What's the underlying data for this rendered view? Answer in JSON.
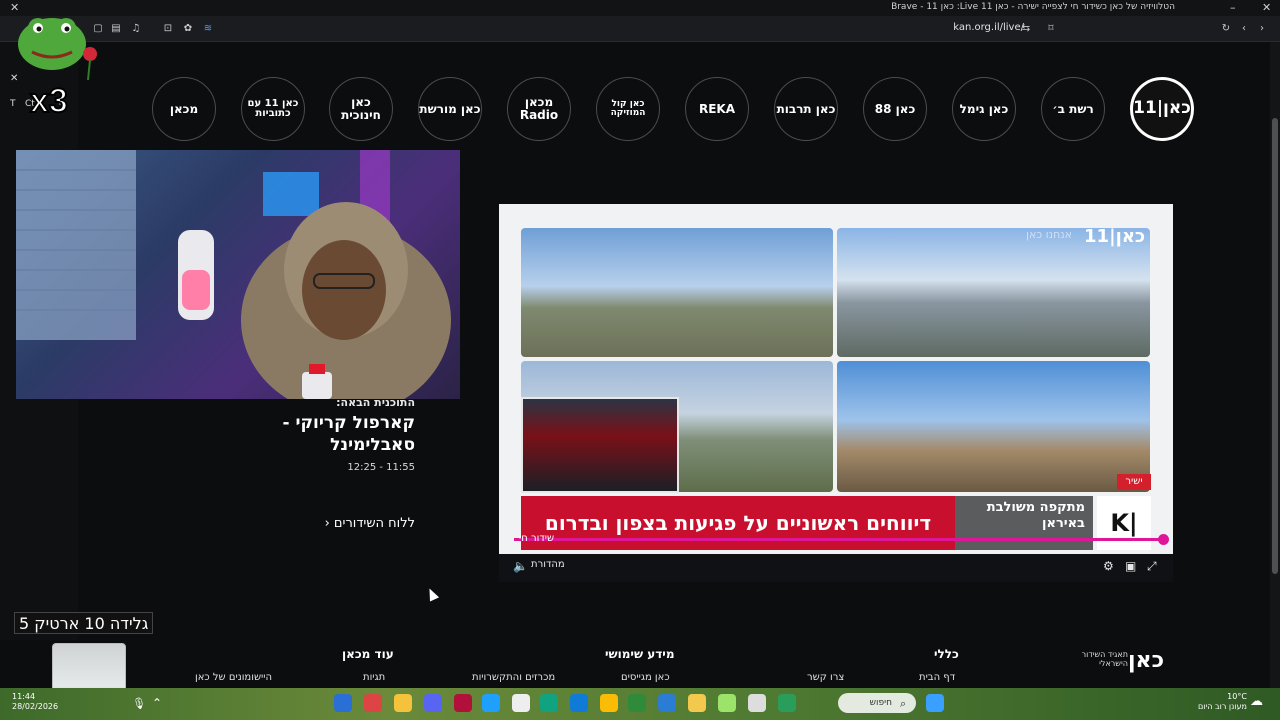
{
  "browser": {
    "window_title": "הטלוויזיה של כאן כשידור חי לצפייה ישירה - כאן 11 Live: כאן 11 - Brave",
    "url": "kan.org.il/live/"
  },
  "channels": [
    {
      "name": "kan11",
      "label": "כאן|11"
    },
    {
      "name": "reshet-bet",
      "label": "רשת ב׳"
    },
    {
      "name": "kan-gimmel",
      "label": "כאן גימל"
    },
    {
      "name": "kan-88",
      "label": "כאן 88"
    },
    {
      "name": "kan-tarbut",
      "label": "כאן תרבות"
    },
    {
      "name": "reka",
      "label": "REKA"
    },
    {
      "name": "kol-hamusika",
      "label": "כאן קול המוזיקה"
    },
    {
      "name": "makan-radio",
      "label": "מכאן Radio"
    },
    {
      "name": "moreshet",
      "label": "כאן מורשת"
    },
    {
      "name": "chinuchit",
      "label": "כאן חינוכית"
    },
    {
      "name": "kan11-subtitles",
      "label": "כאן 11 עם כתוביות"
    },
    {
      "name": "makan",
      "label": "מכאן"
    }
  ],
  "next_program": {
    "label": "התוכנית הבאה:",
    "title": "קארפול קריוקי - סאבלימינל",
    "time": "11:55 - 12:25"
  },
  "schedule_link": "ללוח השידורים",
  "player": {
    "brand_logo": "כאן|11",
    "brand_tagline": "אנחנו כאן",
    "live_badge": "ישיר",
    "ticker_main": "דיווחים ראשוניים על פגיעות בצפון ובדרום",
    "ticker_side": "מתקפה משולבת באיראן",
    "live_label": "שידור חי",
    "mute_label": "מהדורת",
    "progress_fraction": 1.0
  },
  "footer": {
    "org_logo": "כאן",
    "org_name": "תאגיד השידור הישראלי",
    "columns": [
      {
        "heading": "כללי",
        "links": [
          "דף הבית"
        ]
      },
      {
        "heading": "",
        "links": [
          "צרו קשר"
        ]
      },
      {
        "heading": "מידע שימושי",
        "links": [
          "כאן מגייסים"
        ]
      },
      {
        "heading": "",
        "links": [
          "מכרזים והתקשרויות"
        ]
      },
      {
        "heading": "עוד מכאן",
        "links": [
          "תגיות"
        ]
      },
      {
        "heading": "",
        "links": [
          "היישומונים של כאן"
        ]
      }
    ]
  },
  "overlay": {
    "counter": "x3",
    "gelida_text": "גלידה 10 ארטיק 5",
    "obs_tab": "Ctrl",
    "obs_t": "T"
  },
  "taskbar": {
    "time": "11:44",
    "date": "28/02/2026",
    "search_placeholder": "חיפוש",
    "temperature": "10°C",
    "weather": "מעונן רוב היום"
  },
  "colors": {
    "accent_magenta": "#e0169a",
    "ticker_red": "#c8102e",
    "live_red": "#d4202c"
  }
}
